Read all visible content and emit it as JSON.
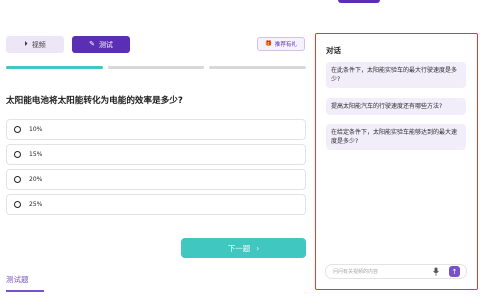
{
  "tabs": [
    {
      "label": "视频",
      "icon": "play-icon"
    },
    {
      "label": "测试",
      "icon": "edit-icon"
    }
  ],
  "reward": {
    "label": "推荐有礼",
    "icon": "gift-icon"
  },
  "progress": {
    "done": 1,
    "total": 3
  },
  "question": {
    "text": "太阳能电池将太阳能转化为电能的效率是多少?"
  },
  "options": [
    {
      "label": "10%"
    },
    {
      "label": "15%"
    },
    {
      "label": "20%"
    },
    {
      "label": "25%"
    }
  ],
  "next_button": {
    "label": "下一题",
    "arrow": "›"
  },
  "bottom_tab": {
    "label": "测试题"
  },
  "chat": {
    "title": "对话",
    "messages": [
      {
        "text": "在此条件下，太阳能实验车的最大行驶速度是多少?"
      },
      {
        "text": "提高太阳能汽车的行驶速度还有哪些方法?"
      },
      {
        "text": "在给定条件下，太阳能实验车能够达到的最大速度是多少?"
      }
    ],
    "input_placeholder": "问问有关视频的内容",
    "send_icon": "arrow-up-icon",
    "mic_icon": "mic-icon"
  },
  "colors": {
    "accent": "#5b2fb5",
    "teal": "#3fc7c0",
    "highlight_border": "#e23b2e"
  }
}
